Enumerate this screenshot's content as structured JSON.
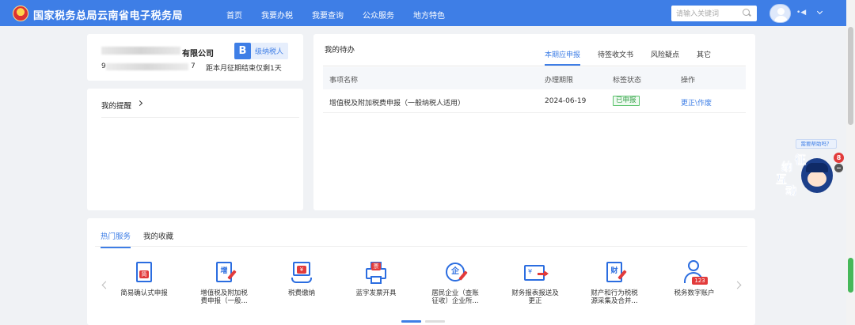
{
  "header": {
    "site_title": "国家税务总局云南省电子税务局",
    "nav": [
      "首页",
      "我要办税",
      "我要查询",
      "公众服务",
      "地方特色"
    ],
    "search_placeholder": "请输入关键词",
    "user_name": "•◀"
  },
  "company": {
    "name_suffix": "有限公司",
    "tax_id_start": "9",
    "tax_id_end": "7",
    "grade_letter": "B",
    "grade_text": "级纳税人",
    "deadline": "距本月征期结束仅剩1天"
  },
  "reminder": {
    "title": "我的提醒"
  },
  "todo": {
    "title": "我的待办",
    "tabs": [
      "本期应申报",
      "待签收文书",
      "风险疑点",
      "其它"
    ],
    "columns": [
      "事项名称",
      "办理期限",
      "标签状态",
      "操作"
    ],
    "rows": [
      {
        "name": "增值税及附加税费申报（一般纳税人适用）",
        "deadline": "2024-06-19",
        "status": "已申报",
        "action": "更正\\作废"
      }
    ]
  },
  "services": {
    "tabs": [
      "热门服务",
      "我的收藏"
    ],
    "items": [
      {
        "label": "简易确认式申报",
        "glyph": "简"
      },
      {
        "label": "增值税及附加税\n费申报（一般...",
        "glyph": "增"
      },
      {
        "label": "税费缴纳",
        "glyph": "¥"
      },
      {
        "label": "蓝字发票开具",
        "glyph": "票"
      },
      {
        "label": "居民企业（查账\n征收）企业所...",
        "glyph": "企"
      },
      {
        "label": "财务报表报送及\n更正",
        "glyph": "¥"
      },
      {
        "label": "财产和行为税税\n源采集及合并...",
        "glyph": "财"
      },
      {
        "label": "税务数字账户",
        "glyph": "123"
      }
    ]
  },
  "assistant": {
    "help_text": "需要帮助吗？",
    "chars": [
      "征",
      "纳",
      "互",
      "动"
    ],
    "badge_count": "8"
  },
  "colors": {
    "primary": "#3e7ee6",
    "accent_red": "#e23b3b",
    "status_green": "#3aa14d"
  }
}
